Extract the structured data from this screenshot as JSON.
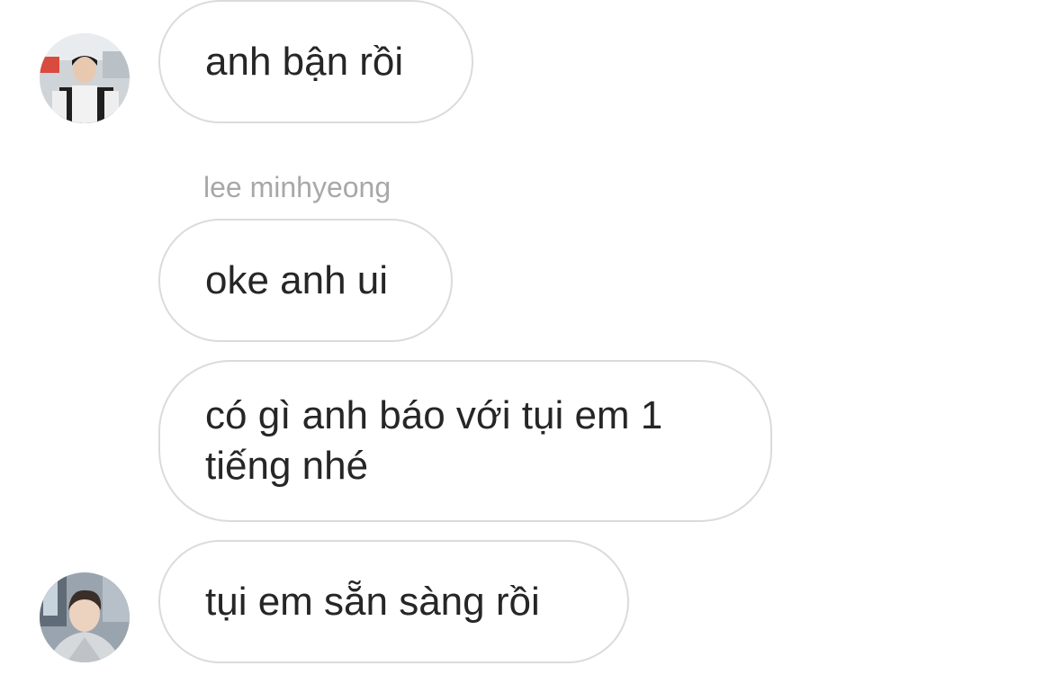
{
  "conversation": {
    "messages": [
      {
        "text": "anh bận rồi"
      },
      {
        "text": "oke anh ui"
      },
      {
        "text": "có gì anh báo với tụi em 1 tiếng nhé"
      },
      {
        "text": "tụi em sẵn sàng rồi"
      }
    ],
    "sender_name": "lee minhyeong",
    "avatars": [
      "profile-photo",
      "profile-photo"
    ]
  },
  "colors": {
    "bubble_border": "#dbdbdb",
    "text": "#262626",
    "sender_label": "#a8a8a8",
    "background": "#ffffff"
  }
}
